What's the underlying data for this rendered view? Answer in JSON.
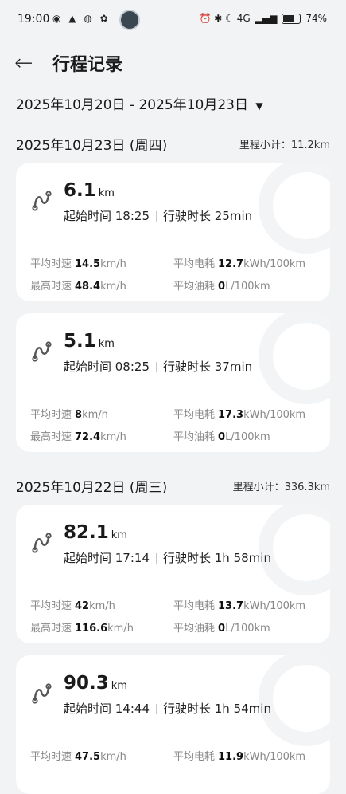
{
  "status_bar": {
    "time": "19:00",
    "left_icons": "◉ ▲ ◍ ✿",
    "right_icons": "⏰ ✱ ☾ 4G",
    "battery": "74%",
    "battery_level": 0.74
  },
  "header": {
    "back_icon": "back-arrow-icon",
    "title": "行程记录"
  },
  "range": {
    "label": "2025年10月20日 - 2025年10月23日",
    "arrow": "▼"
  },
  "days": [
    {
      "date": "2025年10月23日 (周四)",
      "subtotal_label": "里程小计：",
      "subtotal": "11.2km"
    },
    {
      "date": "2025年10月22日 (周三)",
      "subtotal_label": "里程小计：",
      "subtotal": "336.3km"
    }
  ],
  "labels": {
    "start": "起始时间",
    "duration": "行驶时长",
    "avg_speed": "平均时速",
    "max_speed": "最高时速",
    "avg_power": "平均电耗",
    "avg_fuel": "平均油耗",
    "km": "km",
    "kmh": "km/h",
    "power_unit": "kWh/100km",
    "fuel_unit": "L/100km"
  },
  "trips": [
    {
      "distance": "6.1",
      "start": "18:25",
      "duration": "25min",
      "avg_speed": "14.5",
      "max_speed": "48.4",
      "avg_power": "12.7",
      "avg_fuel": "0"
    },
    {
      "distance": "5.1",
      "start": "08:25",
      "duration": "37min",
      "avg_speed": "8",
      "max_speed": "72.4",
      "avg_power": "17.3",
      "avg_fuel": "0"
    },
    {
      "distance": "82.1",
      "start": "17:14",
      "duration": "1h 58min",
      "avg_speed": "42",
      "max_speed": "116.6",
      "avg_power": "13.7",
      "avg_fuel": "0"
    },
    {
      "distance": "90.3",
      "start": "14:44",
      "duration": "1h 54min",
      "avg_speed": "47.5",
      "max_speed": "",
      "avg_power": "11.9",
      "avg_fuel": ""
    }
  ]
}
